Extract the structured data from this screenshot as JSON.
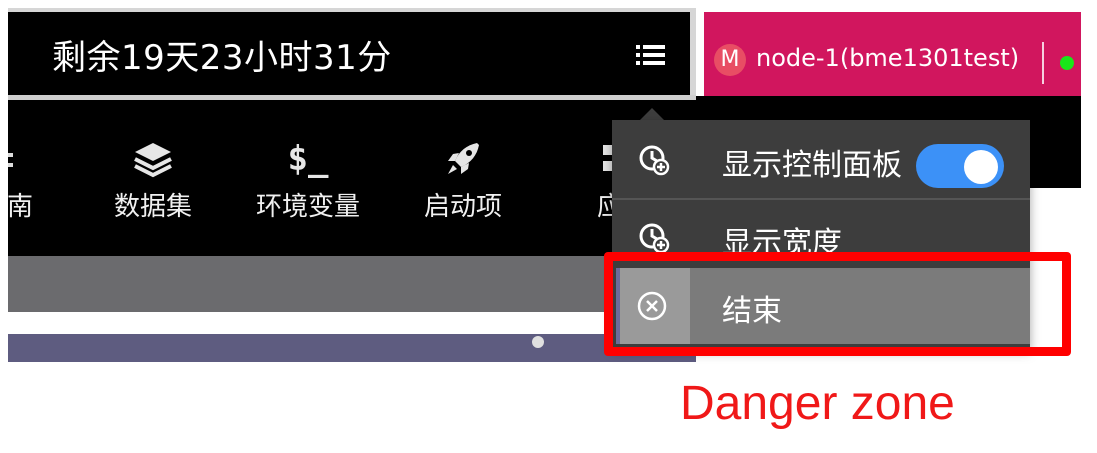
{
  "header": {
    "timer_text": "剩余19天23小时31分",
    "menu_icon": "hamburger-menu-icon"
  },
  "node": {
    "avatar_letter": "M",
    "name": "node-1(bme1301test)",
    "status_color": "#19e619"
  },
  "toolbar": {
    "items": [
      {
        "label": "南",
        "icon": "guide-icon"
      },
      {
        "label": "数据集",
        "icon": "layers-icon"
      },
      {
        "label": "环境变量",
        "icon": "terminal-dollar-icon",
        "icon_text": "$_"
      },
      {
        "label": "启动项",
        "icon": "rocket-icon"
      },
      {
        "label": "应",
        "icon": "app-icon"
      }
    ]
  },
  "dropdown": {
    "items": [
      {
        "label": "显示控制面板",
        "icon": "clock-plus-icon",
        "toggle": true,
        "toggle_on": true
      },
      {
        "label": "显示宽度",
        "icon": "clock-plus-icon"
      },
      {
        "label": "结束",
        "icon": "close-circle-icon"
      }
    ]
  },
  "annotation": {
    "text": "Danger zone",
    "color": "#ff0000"
  },
  "colors": {
    "node_bar": "#d1165e",
    "toggle_on": "#3c91f7",
    "dropdown_bg": "#3d3d3d"
  }
}
